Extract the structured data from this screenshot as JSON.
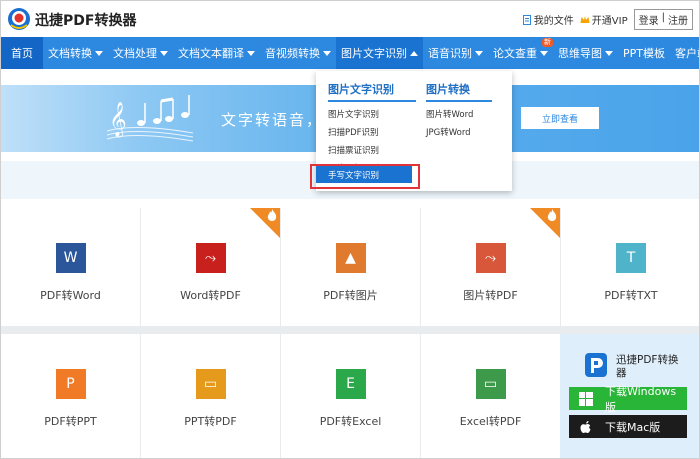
{
  "header": {
    "brand": "迅捷PDF转换器",
    "my_files": "我的文件",
    "vip": "开通VIP",
    "login": "登录",
    "sep": "|",
    "register": "注册"
  },
  "nav": {
    "items": [
      {
        "label": "首页"
      },
      {
        "label": "文档转换"
      },
      {
        "label": "文档处理"
      },
      {
        "label": "文档文本翻译"
      },
      {
        "label": "音视频转换"
      },
      {
        "label": "图片文字识别"
      },
      {
        "label": "语音识别"
      },
      {
        "label": "论文查重",
        "badge": "新"
      },
      {
        "label": "思维导图"
      },
      {
        "label": "PPT模板"
      },
      {
        "label": "客户端"
      }
    ]
  },
  "banner": {
    "text": "文字转语音，",
    "button": "立即查看"
  },
  "dropdown": {
    "col1": {
      "title": "图片文字识别",
      "items": [
        "图片文字识别",
        "扫描PDF识别",
        "扫描票证识别",
        "图片局部识别"
      ],
      "selected": "手写文字识别"
    },
    "col2": {
      "title": "图片转换",
      "items": [
        "图片转Word",
        "JPG转Word"
      ]
    }
  },
  "tools_row1": [
    {
      "label": "PDF转Word",
      "icon": "word-icon",
      "glyph": "W",
      "color": "#2b579a",
      "hot": false
    },
    {
      "label": "Word转PDF",
      "icon": "pdf-icon",
      "glyph": "⤳",
      "color": "#c8211d",
      "hot": true
    },
    {
      "label": "PDF转图片",
      "icon": "image-icon",
      "glyph": "▲",
      "color": "#e07a2e",
      "hot": false
    },
    {
      "label": "图片转PDF",
      "icon": "pdf-icon",
      "glyph": "⤳",
      "color": "#d8563a",
      "hot": true
    },
    {
      "label": "PDF转TXT",
      "icon": "txt-icon",
      "glyph": "T",
      "color": "#4fb3c9",
      "hot": false
    }
  ],
  "tools_row2": [
    {
      "label": "PDF转PPT",
      "icon": "ppt-icon",
      "glyph": "P",
      "color": "#f07a26"
    },
    {
      "label": "PPT转PDF",
      "icon": "ppt-pdf-icon",
      "glyph": "▭",
      "color": "#e69a1c"
    },
    {
      "label": "PDF转Excel",
      "icon": "excel-icon",
      "glyph": "E",
      "color": "#2aa84a"
    },
    {
      "label": "Excel转PDF",
      "icon": "excel-pdf-icon",
      "glyph": "▭",
      "color": "#3d9a4a"
    }
  ],
  "download": {
    "name": "迅捷PDF转换器",
    "windows": "下载Windows版",
    "mac": "下载Mac版"
  }
}
